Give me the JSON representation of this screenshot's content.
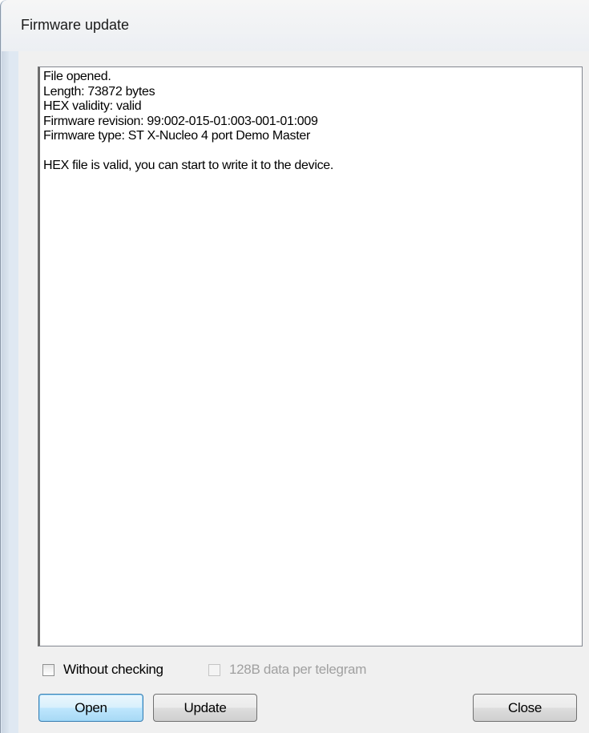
{
  "window": {
    "title": "Firmware update"
  },
  "log": {
    "lines": [
      "File opened.",
      "Length: 73872 bytes",
      "HEX validity: valid",
      "Firmware revision: 99:002-015-01:003-001-01:009",
      "Firmware type: ST X-Nucleo 4 port Demo Master",
      "",
      "HEX file is valid, you can start to write it to the device."
    ]
  },
  "options": {
    "without_checking": {
      "label": "Without checking",
      "checked": false,
      "enabled": true
    },
    "data_per_telegram": {
      "label": "128B data per telegram",
      "checked": false,
      "enabled": false
    }
  },
  "buttons": {
    "open": "Open",
    "update": "Update",
    "close": "Close"
  }
}
